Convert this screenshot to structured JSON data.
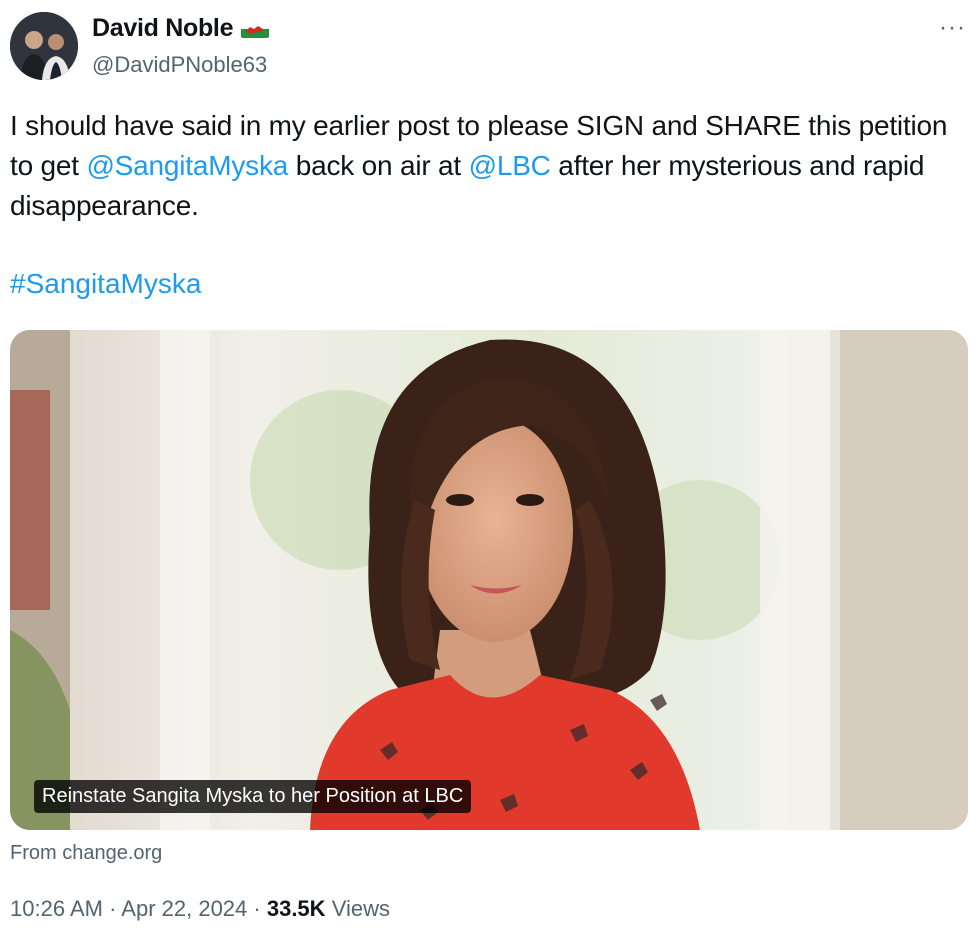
{
  "author": {
    "name": "David Noble",
    "handle": "@DavidPNoble63",
    "flag_icon": "wales-flag-icon"
  },
  "more_label": "···",
  "post": {
    "text_before": "I should have said in my earlier post to please SIGN and SHARE this petition to get ",
    "mention_1": "@SangitaMyska",
    "text_middle": " back on air at ",
    "mention_2": "@LBC",
    "text_after": " after her mysterious and rapid disappearance.",
    "hashtag": "#SangitaMyska"
  },
  "card": {
    "caption": "Reinstate Sangita Myska to her Position at LBC",
    "source": "From change.org"
  },
  "meta": {
    "time": "10:26 AM",
    "separator": " · ",
    "date": "Apr 22, 2024",
    "views_count": "33.5K",
    "views_label": "Views"
  },
  "colors": {
    "link": "#1d9bf0",
    "secondary_text": "#536471",
    "primary_text": "#0f1419"
  }
}
